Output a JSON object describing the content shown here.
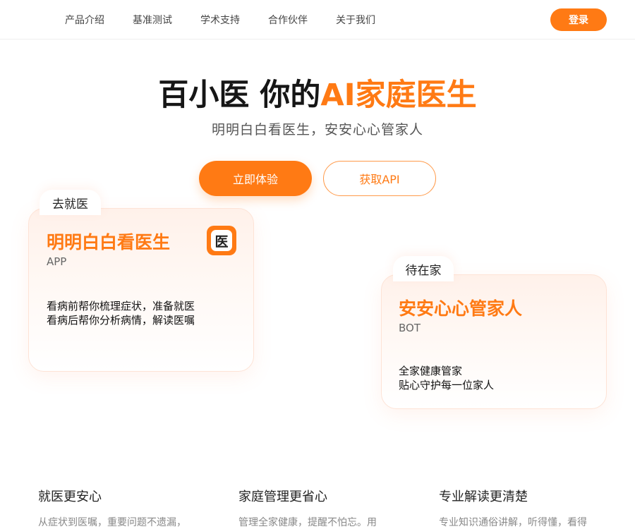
{
  "nav": {
    "links": [
      "产品介绍",
      "基准测试",
      "学术支持",
      "合作伙伴",
      "关于我们"
    ],
    "login_label": "登录"
  },
  "hero": {
    "title_main": "百小医 你的",
    "title_accent": "AI家庭医生",
    "subtitle": "明明白白看医生，安安心心管家人",
    "cta_primary": "立即体验",
    "cta_secondary": "获取API"
  },
  "cards": [
    {
      "tab": "去就医",
      "title": "明明白白看医生",
      "kind": "APP",
      "icon_glyph": "医",
      "desc": [
        "看病前帮你梳理症状，准备就医",
        "看病后帮你分析病情，解读医嘱"
      ]
    },
    {
      "tab": "待在家",
      "title": "安安心心管家人",
      "kind": "BOT",
      "desc": [
        "全家健康管家",
        "贴心守护每一位家人"
      ]
    }
  ],
  "features": [
    {
      "title": "就医更安心",
      "text": "从症状到医嘱，重要问题不遗漏，"
    },
    {
      "title": "家庭管理更省心",
      "text": "管理全家健康，提醒不怕忘。用"
    },
    {
      "title": "专业解读更清楚",
      "text": "专业知识通俗讲解，听得懂，看得"
    }
  ],
  "colors": {
    "accent": "#ff7a14",
    "text": "#161616",
    "muted": "#888888"
  },
  "icons": {
    "app_icon": "medical-app-icon"
  }
}
